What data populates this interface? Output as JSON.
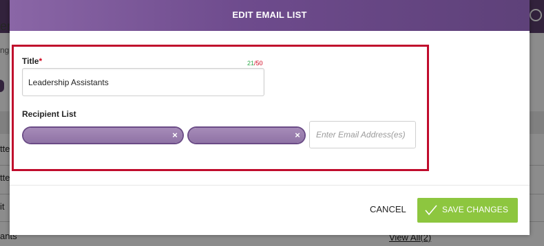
{
  "background": {
    "header_fragment": "er",
    "sub_fragment": "ng",
    "row_fragments": [
      "tte",
      "tte",
      "it",
      "ants"
    ],
    "view_all_link": "View All(2)"
  },
  "modal": {
    "title": "EDIT EMAIL LIST",
    "title_field": {
      "label": "Title",
      "required_marker": "*",
      "value": "Leadership Assistants",
      "counter_used": "21",
      "counter_sep": "/",
      "counter_max": "50"
    },
    "recipient_field": {
      "label": "Recipient List",
      "chips": [
        {
          "close": "×"
        },
        {
          "close": "×"
        }
      ],
      "email_placeholder": "Enter Email Address(es)"
    },
    "footer": {
      "cancel_label": "CANCEL",
      "save_label": "SAVE CHANGES"
    }
  },
  "colors": {
    "header_purple": "#6e4b8d",
    "chip_fill": "#9a7fb0",
    "highlight_red": "#c00b2c",
    "save_green": "#8dc63f",
    "counter_green": "#2ea84a",
    "required_red": "#d0021b"
  },
  "icons": {
    "chat": "chat-bubble-icon",
    "chip_close": "close-icon",
    "save": "checkmark-icon"
  }
}
